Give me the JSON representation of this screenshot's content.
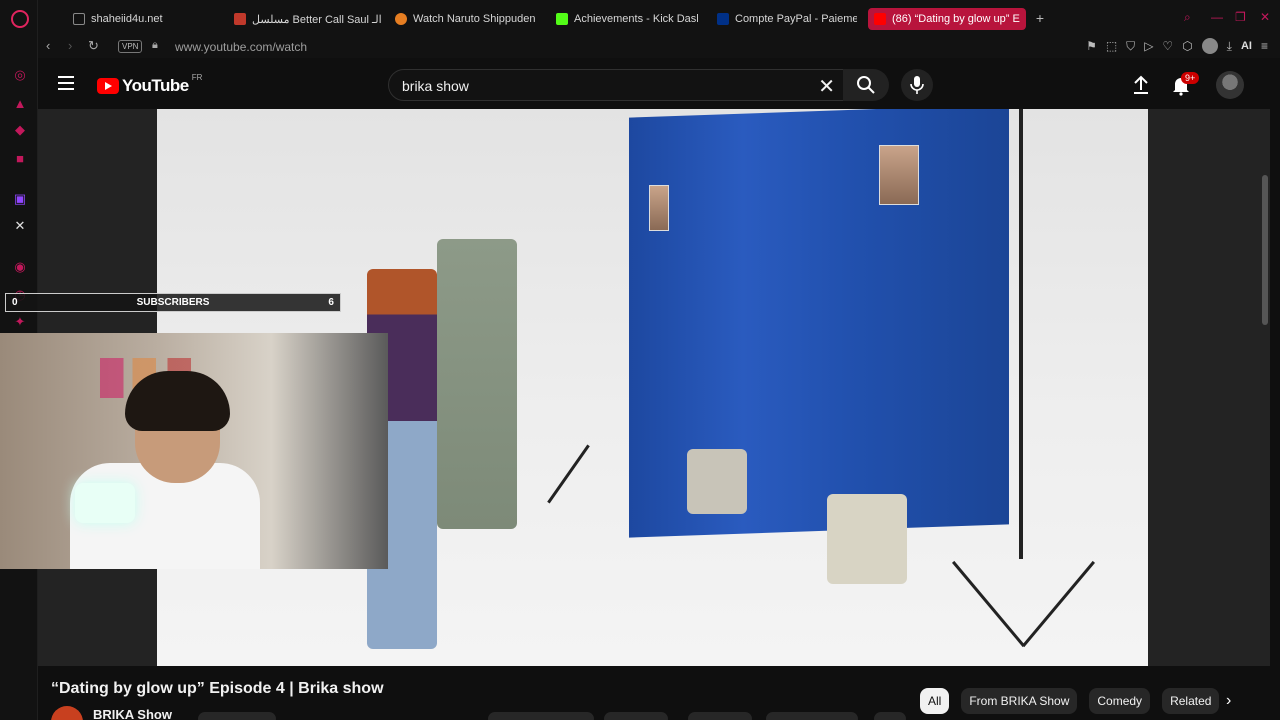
{
  "browser": {
    "tabs": [
      {
        "label": "shaheiid4u.net",
        "favicon_color": "#888888"
      },
      {
        "label": "مسلسل Better Call Saul الـ",
        "favicon_color": "#c0392b"
      },
      {
        "label": "Watch Naruto Shippuden",
        "favicon_color": "#e67e22"
      },
      {
        "label": "Achievements - Kick Dash",
        "favicon_color": "#53fc18"
      },
      {
        "label": "Compte PayPal - Paiemen",
        "favicon_color": "#003087"
      },
      {
        "label": "(86) “Dating by glow up” E",
        "favicon_color": "#ff0000"
      }
    ],
    "vpn_label": "VPN",
    "url": "www.youtube.com/watch",
    "ai_label": "AI",
    "accent": "#b8143c"
  },
  "youtube": {
    "logo_text": "YouTube",
    "country_code": "FR",
    "search_value": "brika show",
    "notification_count": "9+"
  },
  "overlay": {
    "subscribers_label": "SUBSCRIBERS",
    "subscribers_left": "0",
    "subscribers_right": "6"
  },
  "video": {
    "title": "“Dating by glow up” Episode 4 | Brika show",
    "channel_name": "BRIKA Show"
  },
  "chips": [
    "All",
    "From BRIKA Show",
    "Comedy",
    "Related"
  ]
}
